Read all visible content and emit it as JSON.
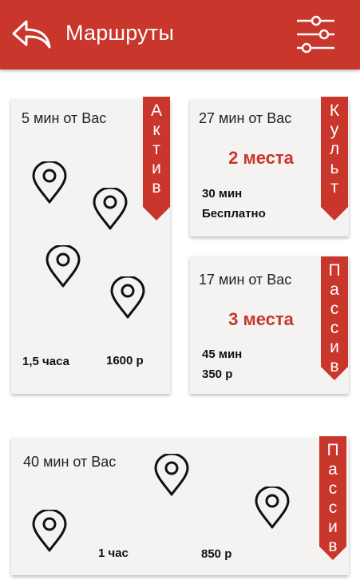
{
  "header": {
    "title": "Маршруты",
    "back_icon": "back-arrow-icon",
    "filter_icon": "filter-sliders-icon",
    "color": "#c9362b"
  },
  "accent_color": "#c9362b",
  "routes": [
    {
      "distance": "5 мин от Вас",
      "category": [
        "А",
        "к",
        "т",
        "и",
        "в"
      ],
      "duration": "1,5 часа",
      "price": "1600 р"
    },
    {
      "distance": "27 мин от Вас",
      "category": [
        "К",
        "у",
        "л",
        "ь",
        "т"
      ],
      "places": "2 места",
      "duration": "30 мин",
      "price": "Бесплатно"
    },
    {
      "distance": "17 мин от Вас",
      "category": [
        "П",
        "а",
        "с",
        "с",
        "и",
        "в"
      ],
      "places": "3 места",
      "duration": "45 мин",
      "price": "350 р"
    },
    {
      "distance": "40 мин от Вас",
      "category": [
        "П",
        "а",
        "с",
        "с",
        "и",
        "в"
      ],
      "duration": "1 час",
      "price": "850 р"
    }
  ]
}
